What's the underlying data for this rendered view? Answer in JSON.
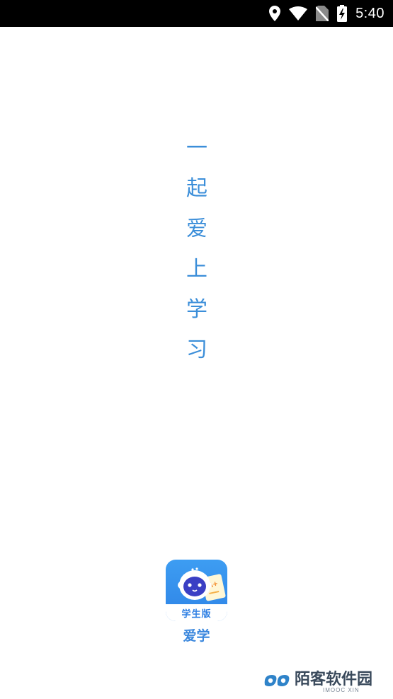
{
  "status_bar": {
    "time": "5:40",
    "icons": [
      "location-icon",
      "wifi-icon",
      "no-sim-icon",
      "battery-charging-icon"
    ]
  },
  "splash": {
    "slogan": [
      "一",
      "起",
      "爱",
      "上",
      "学",
      "习"
    ],
    "slogan_color": "#3b8ed9"
  },
  "app": {
    "icon_badge": "学生版",
    "name": "爱学",
    "brand_color": "#2e83e6"
  },
  "watermark": {
    "title": "陌客软件园",
    "subtitle": "IMOOC XIN"
  }
}
